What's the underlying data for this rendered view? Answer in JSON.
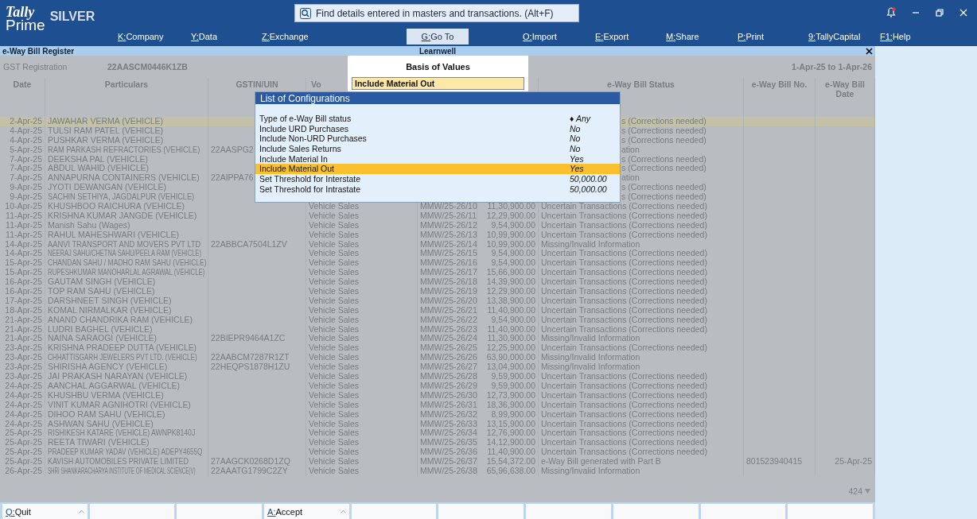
{
  "header": {
    "logo_top": "Tally",
    "logo_bottom": "Prime",
    "edition": "SILVER",
    "search": {
      "placeholder": "Find details entered in masters and transactions. (Alt+F)"
    },
    "menu": [
      {
        "key": "K:",
        "label": "Company",
        "selected": false
      },
      {
        "key": "Y:",
        "label": "Data",
        "selected": false
      },
      {
        "key": "Z:",
        "label": "Exchange",
        "selected": false
      },
      {
        "key": "G:",
        "label": "Go To",
        "selected": true
      },
      {
        "key": "O:",
        "label": "Import",
        "selected": false
      },
      {
        "key": "E:",
        "label": "Export",
        "selected": false
      },
      {
        "key": "M:",
        "label": "Share",
        "selected": false
      },
      {
        "key": "P:",
        "label": "Print",
        "selected": false
      },
      {
        "key": "9:",
        "label": "TallyCapital",
        "selected": false
      },
      {
        "key": "F1:",
        "label": "Help",
        "selected": false
      }
    ]
  },
  "window": {
    "title": "e-Way Bill Register",
    "company": "Learnwell"
  },
  "report": {
    "gst_label": "GST Registration",
    "gst_value": "22AASCM0446K1ZB",
    "period": "1-Apr-25 to 1-Apr-26"
  },
  "table": {
    "columns": [
      {
        "label": "Date"
      },
      {
        "label": "Particulars"
      },
      {
        "label": "GSTIN/UIN"
      },
      {
        "label": "Vo"
      },
      {
        "label": "e-Way Bill Status"
      },
      {
        "label": "e-Way Bill No."
      },
      {
        "label": "e-Way Bill Date"
      }
    ],
    "rows": [
      {
        "date": "2-Apr-25",
        "particulars": "JAWAHAR VERMA (VEHICLE)",
        "status": "s (Corrections needed)",
        "selected": true
      },
      {
        "date": "4-Apr-25",
        "particulars": "TULSI RAM PATEL (VEHICLE)",
        "status": "s (Corrections needed)",
        "selected": false
      },
      {
        "date": "4-Apr-25",
        "particulars": "PUSHKAR VERMA (VEHICLE)",
        "status": "s (Corrections needed)",
        "selected": false
      },
      {
        "date": "5-Apr-25",
        "particulars": "RAM PARKASH REFRACTORIES (VEHICLE)",
        "gstin": "22AASPG2",
        "status": "ation",
        "selected": false
      },
      {
        "date": "7-Apr-25",
        "particulars": "DEEKSHA PAL (VEHICLE)",
        "status": "s (Corrections needed)",
        "selected": false
      },
      {
        "date": "7-Apr-25",
        "particulars": "ABDUL WAHID (VEHICLE)",
        "status": "s (Corrections needed)",
        "selected": false
      },
      {
        "date": "7-Apr-25",
        "particulars": "ANNAPURNA CONTAINERS (VEHICLE)",
        "gstin": "22AIPPA76",
        "status": "ation",
        "selected": false
      },
      {
        "date": "9-Apr-25",
        "particulars": "JYOTI DEWANGAN (VEHICLE)",
        "status": "s (Corrections needed)",
        "selected": false
      },
      {
        "date": "9-Apr-25",
        "particulars": "SACHIN SETHIYA, JAGDALPUR (VEHICLE)",
        "status": "s (Corrections needed)",
        "selected": false
      },
      {
        "date": "10-Apr-25",
        "particulars": "KHUSHBOO RAICHURA (VEHICLE)",
        "voucher_type": "Vehicle Sales",
        "voucher_no": "MMW/25-26/10",
        "amount": "11,30,900.00",
        "status": "Uncertain Transactions (Corrections needed)",
        "selected": false
      },
      {
        "date": "11-Apr-25",
        "particulars": "KRISHNA KUMAR JANGDE (VEHICLE)",
        "voucher_type": "Vehicle Sales",
        "voucher_no": "MMW/25-26/11",
        "amount": "12,29,900.00",
        "status": "Uncertain Transactions (Corrections needed)",
        "selected": false
      },
      {
        "date": "11-Apr-25",
        "particulars": "Manish Sahu (Wages)",
        "voucher_type": "Vehicle Sales",
        "voucher_no": "MMW/25-26/12",
        "amount": "9,54,900.00",
        "status": "Uncertain Transactions (Corrections needed)",
        "selected": false
      },
      {
        "date": "11-Apr-25",
        "particulars": "RAHUL MAHESHWARI (VEHICLE)",
        "voucher_type": "Vehicle Sales",
        "voucher_no": "MMW/25-26/13",
        "amount": "10,99,900.00",
        "status": "Uncertain Transactions (Corrections needed)",
        "selected": false
      },
      {
        "date": "14-Apr-25",
        "particulars": "AANVI TRANSPORT AND MOVERS PVT LTD",
        "gstin": "22ABBCA7504L1ZV",
        "voucher_type": "Vehicle Sales",
        "voucher_no": "MMW/25-26/14",
        "amount": "10,99,900.00",
        "status": "Missing/Invalid Information",
        "selected": false
      },
      {
        "date": "14-Apr-25",
        "particulars": "NEERAJ SAHU/CHETNA SAHU/PEELA RAM (VEHICLE)",
        "voucher_type": "Vehicle Sales",
        "voucher_no": "MMW/25-26/15",
        "amount": "9,54,900.00",
        "status": "Uncertain Transactions (Corrections needed)",
        "selected": false
      },
      {
        "date": "15-Apr-25",
        "particulars": "CHANDAN SAHU / MADHO RAM SAHU (VEHICLE)",
        "voucher_type": "Vehicle Sales",
        "voucher_no": "MMW/25-26/16",
        "amount": "9,54,900.00",
        "status": "Uncertain Transactions (Corrections needed)",
        "selected": false
      },
      {
        "date": "15-Apr-25",
        "particulars": "RUPESHKUMAR MANOHARLAL AGRAWAL (VEHICLE)",
        "voucher_type": "Vehicle Sales",
        "voucher_no": "MMW/25-26/17",
        "amount": "15,66,900.00",
        "status": "Uncertain Transactions (Corrections needed)",
        "selected": false
      },
      {
        "date": "16-Apr-25",
        "particulars": "GAUTAM SINGH (VEHICLE)",
        "voucher_type": "Vehicle Sales",
        "voucher_no": "MMW/25-26/18",
        "amount": "14,39,900.00",
        "status": "Uncertain Transactions (Corrections needed)",
        "selected": false
      },
      {
        "date": "16-Apr-25",
        "particulars": "TOP RAM SAHU (VEHICLE)",
        "voucher_type": "Vehicle Sales",
        "voucher_no": "MMW/25-26/19",
        "amount": "12,29,900.00",
        "status": "Uncertain Transactions (Corrections needed)",
        "selected": false
      },
      {
        "date": "17-Apr-25",
        "particulars": "DARSHNEET SINGH (VEHICLE)",
        "voucher_type": "Vehicle Sales",
        "voucher_no": "MMW/25-26/20",
        "amount": "13,38,900.00",
        "status": "Uncertain Transactions (Corrections needed)",
        "selected": false
      },
      {
        "date": "18-Apr-25",
        "particulars": "KOMAL NIRMALKAR (VEHICLE)",
        "voucher_type": "Vehicle Sales",
        "voucher_no": "MMW/25-26/21",
        "amount": "11,40,900.00",
        "status": "Uncertain Transactions (Corrections needed)",
        "selected": false
      },
      {
        "date": "21-Apr-25",
        "particulars": "ANAND CHANDRIKA RAM (VEHICLE)",
        "voucher_type": "Vehicle Sales",
        "voucher_no": "MMW/25-26/22",
        "amount": "9,54,900.00",
        "status": "Uncertain Transactions (Corrections needed)",
        "selected": false
      },
      {
        "date": "21-Apr-25",
        "particulars": "LUDRI BAGHEL (VEHICLE)",
        "voucher_type": "Vehicle Sales",
        "voucher_no": "MMW/25-26/23",
        "amount": "11,40,900.00",
        "status": "Uncertain Transactions (Corrections needed)",
        "selected": false
      },
      {
        "date": "21-Apr-25",
        "particulars": "NAINA SARAOGI (VEHICLE)",
        "gstin": "22BIEPR9464A1ZC",
        "voucher_type": "Vehicle Sales",
        "voucher_no": "MMW/25-26/24",
        "amount": "11,30,900.00",
        "status": "Missing/Invalid Information",
        "selected": false
      },
      {
        "date": "23-Apr-25",
        "particulars": "KRISHNA PRADEEP DUTTA (VEHICLE)",
        "voucher_type": "Vehicle Sales",
        "voucher_no": "MMW/25-26/25",
        "amount": "12,25,900.00",
        "status": "Uncertain Transactions (Corrections needed)",
        "selected": false
      },
      {
        "date": "23-Apr-25",
        "particulars": "CHHATTISGARH JEWELERS PVT LTD. (VEHICLE)",
        "gstin": "22AABCM7287R1ZT",
        "voucher_type": "Vehicle Sales",
        "voucher_no": "MMW/25-26/26",
        "amount": "63,90,000.00",
        "status": "Missing/Invalid Information",
        "selected": false
      },
      {
        "date": "23-Apr-25",
        "particulars": "SHIRISHA AGENCY (VEHICLE)",
        "gstin": "22HEQPS1878H1ZU",
        "voucher_type": "Vehicle Sales",
        "voucher_no": "MMW/25-26/27",
        "amount": "13,04,900.00",
        "status": "Missing/Invalid Information",
        "selected": false
      },
      {
        "date": "23-Apr-25",
        "particulars": "JAI PRAKASH NARAYAN (VEHICLE)",
        "voucher_type": "Vehicle Sales",
        "voucher_no": "MMW/25-26/28",
        "amount": "9,59,900.00",
        "status": "Uncertain Transactions (Corrections needed)",
        "selected": false
      },
      {
        "date": "24-Apr-25",
        "particulars": "AANCHAL AGGARWAL (VEHICLE)",
        "voucher_type": "Vehicle Sales",
        "voucher_no": "MMW/25-26/29",
        "amount": "9,59,900.00",
        "status": "Uncertain Transactions (Corrections needed)",
        "selected": false
      },
      {
        "date": "24-Apr-25",
        "particulars": "KHUSHBU VERMA (VEHICLE)",
        "voucher_type": "Vehicle Sales",
        "voucher_no": "MMW/25-26/30",
        "amount": "12,73,900.00",
        "status": "Uncertain Transactions (Corrections needed)",
        "selected": false
      },
      {
        "date": "24-Apr-25",
        "particulars": "VINIT KUMAR AGNIHOTRI (VEHICLE)",
        "voucher_type": "Vehicle Sales",
        "voucher_no": "MMW/25-26/31",
        "amount": "18,36,900.00",
        "status": "Uncertain Transactions (Corrections needed)",
        "selected": false
      },
      {
        "date": "24-Apr-25",
        "particulars": "DIHOO RAM SAHU (VEHICLE)",
        "voucher_type": "Vehicle Sales",
        "voucher_no": "MMW/25-26/32",
        "amount": "8,99,900.00",
        "status": "Uncertain Transactions (Corrections needed)",
        "selected": false
      },
      {
        "date": "24-Apr-25",
        "particulars": "ASHWAN SAHU (VEHICLE)",
        "voucher_type": "Vehicle Sales",
        "voucher_no": "MMW/25-26/33",
        "amount": "13,15,900.00",
        "status": "Uncertain Transactions (Corrections needed)",
        "selected": false
      },
      {
        "date": "25-Apr-25",
        "particulars": "RISHIKESH KATARE (VEHICLE) AWNPK8140J",
        "voucher_type": "Vehicle Sales",
        "voucher_no": "MMW/25-26/34",
        "amount": "12,76,900.00",
        "status": "Uncertain Transactions (Corrections needed)",
        "selected": false
      },
      {
        "date": "25-Apr-25",
        "particulars": "REETA TIWARI (VEHICLE)",
        "voucher_type": "Vehicle Sales",
        "voucher_no": "MMW/25-26/35",
        "amount": "14,12,900.00",
        "status": "Uncertain Transactions (Corrections needed)",
        "selected": false
      },
      {
        "date": "25-Apr-25",
        "particulars": "PRADEEP KUMAR YADAV (VEHICLE) ADEPY4655Q",
        "voucher_type": "Vehicle Sales",
        "voucher_no": "MMW/25-26/36",
        "amount": "11,40,900.00",
        "status": "Uncertain Transactions (Corrections needed)",
        "selected": false
      },
      {
        "date": "25-Apr-25",
        "particulars": "KAVISH AUTOMOBILES PRIVATE LIMITED",
        "gstin": "27AAGCK0268D1ZQ",
        "voucher_type": "Vehicle Sales",
        "voucher_no": "MMW/25-26/37",
        "amount": "15,54,372.00",
        "status": "e-Way Bill generated with Part B",
        "ewb_no": "801523940415",
        "ewb_date": "25-Apr-25",
        "selected": false
      },
      {
        "date": "26-Apr-25",
        "particulars": "SHRI SHANKARACHARYA INSTITUTE OF MEDICAL SCIENCE(V)",
        "gstin": "22AAATG1799C2ZY",
        "voucher_type": "Vehicle Sales",
        "voucher_no": "MMW/25-26/38",
        "amount": "65,96,638.00",
        "status": "Missing/Invalid Information",
        "selected": false
      }
    ],
    "total_count": "424"
  },
  "basis_popup": {
    "title": "Basis of Values",
    "value": "Include Material Out"
  },
  "config_popup": {
    "title": "List of Configurations",
    "items": [
      {
        "label": "Type of e-Way Bill status",
        "value": "♦ Any",
        "selected": false
      },
      {
        "label": "Include URD Purchases",
        "value": "No",
        "selected": false
      },
      {
        "label": "Include Non-URD Purchases",
        "value": "No",
        "selected": false
      },
      {
        "label": "Include Sales Returns",
        "value": "No",
        "selected": false
      },
      {
        "label": "Include Material In",
        "value": "Yes",
        "selected": false
      },
      {
        "label": "Include Material Out",
        "value": "Yes",
        "selected": true
      },
      {
        "label": "Set Threshold for Interstate",
        "value": "50,000.00",
        "selected": false
      },
      {
        "label": "Set Threshold for Intrastate",
        "value": "50,000.00",
        "selected": false
      }
    ]
  },
  "buttons": [
    {
      "kind": "key",
      "key": "Q:",
      "label": "Quit"
    },
    {
      "kind": "empty"
    },
    {
      "kind": "empty"
    },
    {
      "kind": "key",
      "key": "A:",
      "label": "Accept"
    },
    {
      "kind": "empty"
    },
    {
      "kind": "empty"
    },
    {
      "kind": "empty"
    },
    {
      "kind": "empty"
    },
    {
      "kind": "empty"
    },
    {
      "kind": "empty"
    }
  ]
}
